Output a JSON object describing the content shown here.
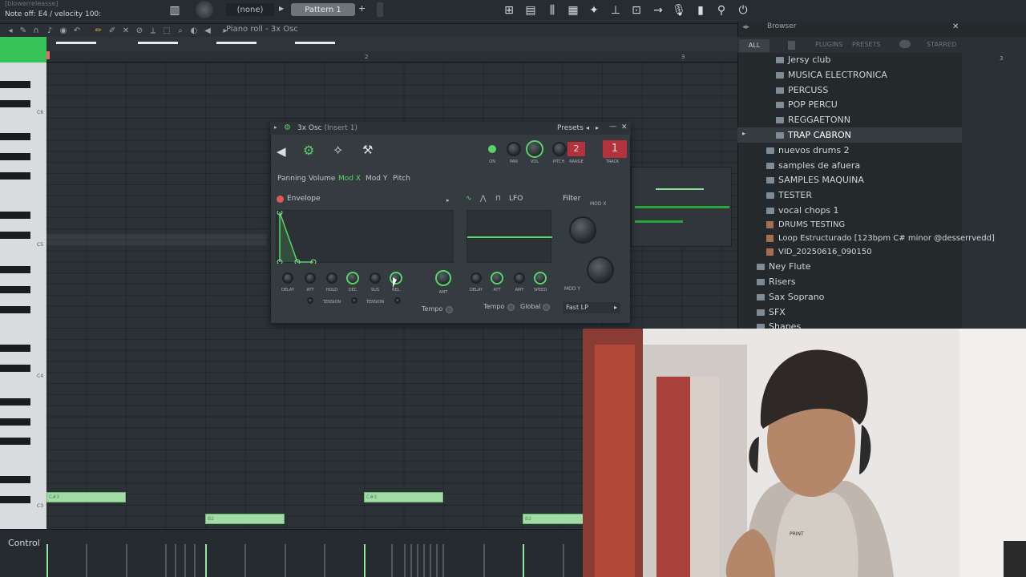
{
  "topbar": {
    "hint_top": "[blowerreleasse]",
    "hint_main": "Note off: E4 / velocity 100:",
    "channel_select": "(none)",
    "pattern": "Pattern 1"
  },
  "pianoroll": {
    "title": "Piano roll - 3x Osc",
    "ruler": [
      "2",
      "3"
    ],
    "key_labels": [
      "C6",
      "C5",
      "C4",
      "C3"
    ],
    "notes": [
      {
        "label": "C#3"
      },
      {
        "label": "B2"
      },
      {
        "label": "C#3"
      },
      {
        "label": "B2"
      }
    ],
    "control_label": "Control"
  },
  "browser": {
    "title": "Browser",
    "tabs": [
      "ALL",
      "PLUGINS",
      "PRESETS",
      "STARRED"
    ],
    "items": [
      {
        "label": "Jersy club",
        "type": "folder"
      },
      {
        "label": "MUSICA ELECTRONICA",
        "type": "folder"
      },
      {
        "label": "PERCUSS",
        "type": "folder"
      },
      {
        "label": "POP PERCU",
        "type": "folder"
      },
      {
        "label": "REGGAETONN",
        "type": "folder"
      },
      {
        "label": "TRAP CABRON",
        "type": "folder"
      },
      {
        "label": "nuevos drums 2",
        "type": "folder"
      },
      {
        "label": "samples de afuera",
        "type": "folder"
      },
      {
        "label": "SAMPLES MAQUINA",
        "type": "folder"
      },
      {
        "label": "TESTER",
        "type": "folder"
      },
      {
        "label": "vocal chops 1",
        "type": "folder"
      },
      {
        "label": "DRUMS TESTING",
        "type": "file"
      },
      {
        "label": "Loop Estructurado [123bpm C# minor @desserrvedd]",
        "type": "file"
      },
      {
        "label": "VID_20250616_090150",
        "type": "file"
      },
      {
        "label": "Ney Flute",
        "type": "folder"
      },
      {
        "label": "Risers",
        "type": "folder"
      },
      {
        "label": "Sax Soprano",
        "type": "folder"
      },
      {
        "label": "SFX",
        "type": "folder"
      },
      {
        "label": "Shapes",
        "type": "folder"
      }
    ]
  },
  "plugin": {
    "title": "3x Osc",
    "insert": "(Insert 1)",
    "presets_label": "Presets",
    "on_label": "ON",
    "pan_label": "PAN",
    "vol_label": "VOL",
    "pitch_label": "PITCH",
    "range_label": "RANGE",
    "range_value": "2",
    "track_label": "TRACK",
    "track_value": "1",
    "subtabs": [
      "Panning",
      "Volume",
      "Mod X",
      "Mod Y",
      "Pitch"
    ],
    "active_subtab": "Mod X",
    "envelope_label": "Envelope",
    "lfo_label": "LFO",
    "filter_label": "Filter",
    "modx_label": "MOD X",
    "mody_label": "MOD Y",
    "env_knobs": [
      "DELAY",
      "ATT",
      "HOLD",
      "DEC",
      "SUS",
      "REL"
    ],
    "tension_label": "TENSION",
    "amt_label": "AMT",
    "tempo_label": "Tempo",
    "lfo_knobs": [
      "DELAY",
      "ATT",
      "AMT",
      "SPEED"
    ],
    "global_label": "Global",
    "filter_type": "Fast LP"
  },
  "colors": {
    "accent_green": "#59d36a",
    "note_green": "#a2dba6",
    "track_red": "#b4323c"
  }
}
